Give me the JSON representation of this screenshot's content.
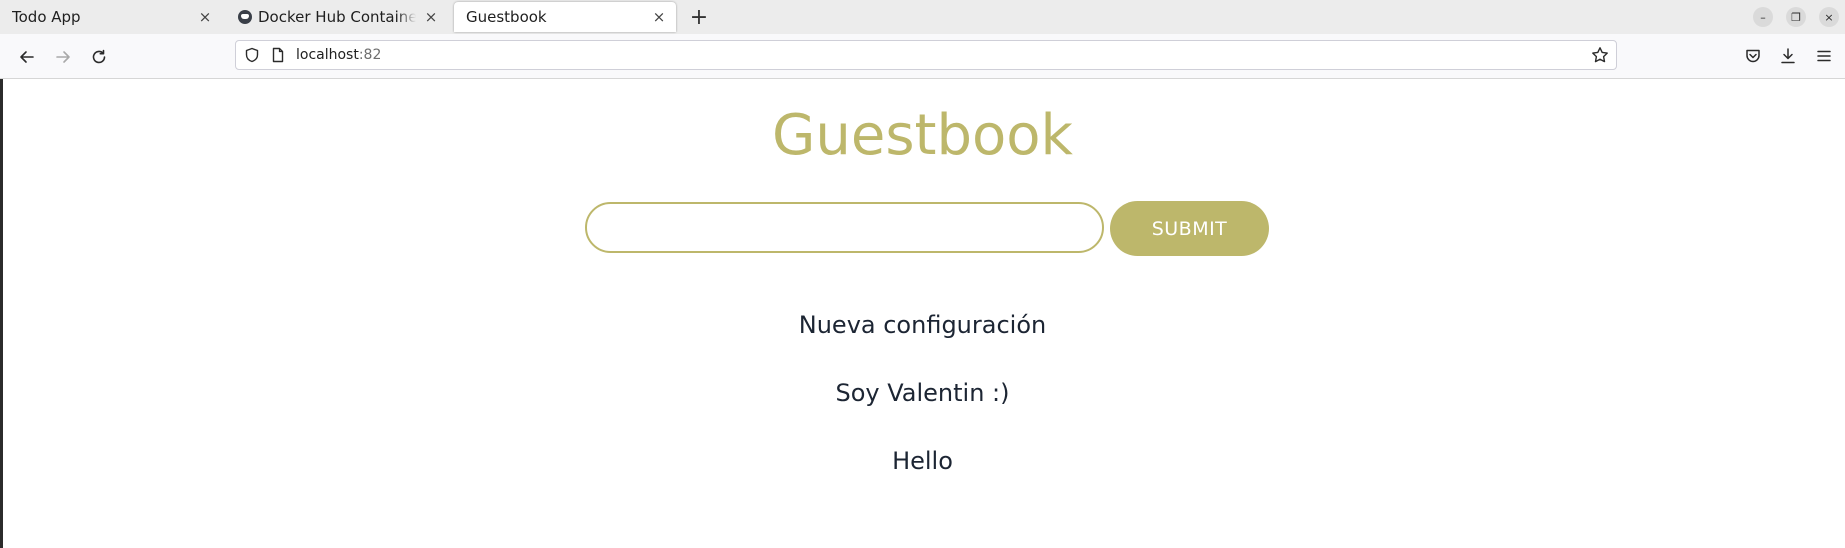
{
  "browser": {
    "tabs": [
      {
        "label": "Todo App",
        "active": false,
        "favicon": "none"
      },
      {
        "label": "Docker Hub Container Image Library",
        "active": false,
        "favicon": "docker-whale-icon"
      },
      {
        "label": "Guestbook",
        "active": true,
        "favicon": "none"
      }
    ],
    "tab_close_glyph": "×",
    "new_tab_glyph": "+",
    "window_controls": {
      "minimize": "–",
      "restore": "❐",
      "close": "×"
    },
    "url": {
      "host": "localhost",
      "port": ":82"
    },
    "icons": {
      "back": "arrow-left-icon",
      "forward": "arrow-right-icon",
      "reload": "reload-icon",
      "shield": "shield-icon",
      "page": "page-icon",
      "star": "star-icon",
      "pocket": "pocket-icon",
      "downloads": "download-icon",
      "menu": "hamburger-menu-icon"
    }
  },
  "page": {
    "title": "Guestbook",
    "input": {
      "value": "",
      "placeholder": ""
    },
    "submit_label": "SUBMIT",
    "accent_color": "#bdb76b",
    "entries": [
      "Nueva configuración",
      "Soy Valentin :)",
      "Hello"
    ]
  }
}
